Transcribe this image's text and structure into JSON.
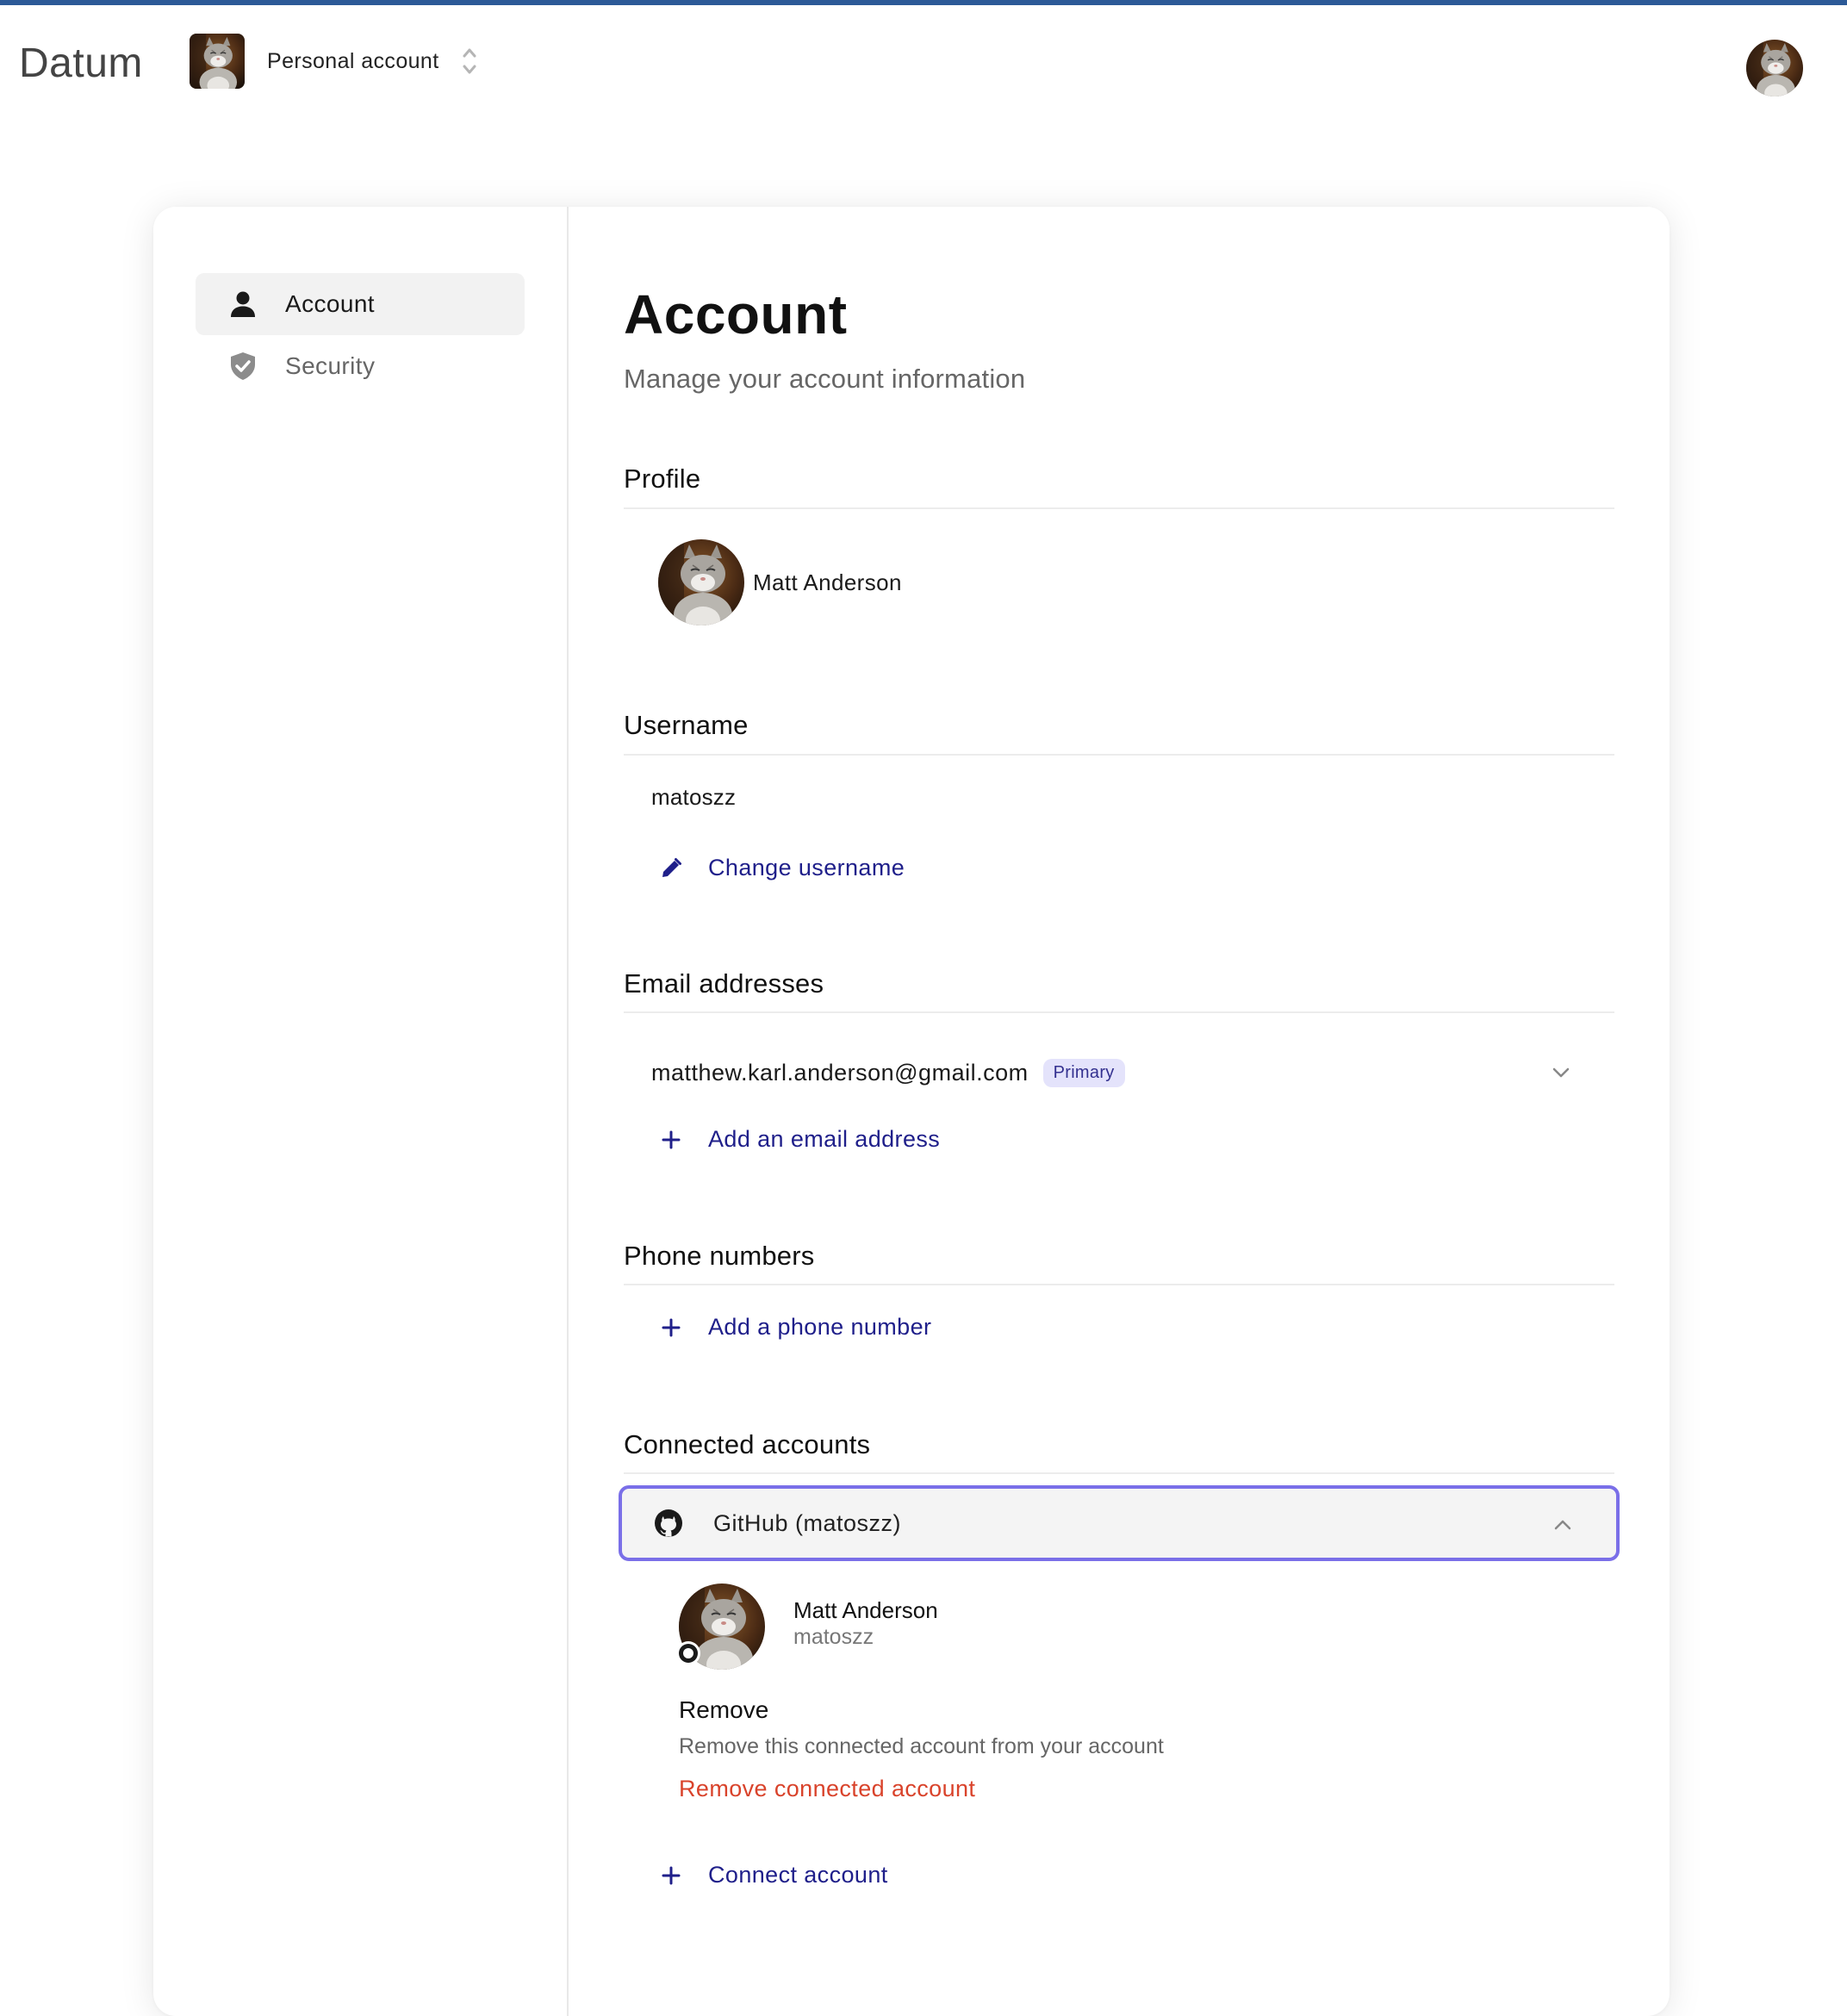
{
  "header": {
    "brand": "Datum",
    "account_switcher_label": "Personal account"
  },
  "sidebar": {
    "items": [
      {
        "label": "Account",
        "icon": "person-icon",
        "active": true
      },
      {
        "label": "Security",
        "icon": "shield-check-icon",
        "active": false
      }
    ]
  },
  "main": {
    "title": "Account",
    "subtitle": "Manage your account information",
    "profile": {
      "section_title": "Profile",
      "name": "Matt Anderson"
    },
    "username": {
      "section_title": "Username",
      "value": "matoszz",
      "change_label": "Change username"
    },
    "emails": {
      "section_title": "Email addresses",
      "items": [
        {
          "address": "matthew.karl.anderson@gmail.com",
          "badge": "Primary"
        }
      ],
      "add_label": "Add an email address"
    },
    "phones": {
      "section_title": "Phone numbers",
      "add_label": "Add a phone number"
    },
    "connected": {
      "section_title": "Connected accounts",
      "account_label": "GitHub (matoszz)",
      "detail_name": "Matt Anderson",
      "detail_username": "matoszz",
      "remove_title": "Remove",
      "remove_description": "Remove this connected account from your account",
      "remove_link": "Remove connected account",
      "connect_label": "Connect account"
    }
  },
  "colors": {
    "accent_link": "#1f1f8a",
    "focus_border": "#7a6fe8",
    "danger": "#d9432b",
    "badge_bg": "#e4e3fb",
    "top_bar": "#2c5a97"
  }
}
